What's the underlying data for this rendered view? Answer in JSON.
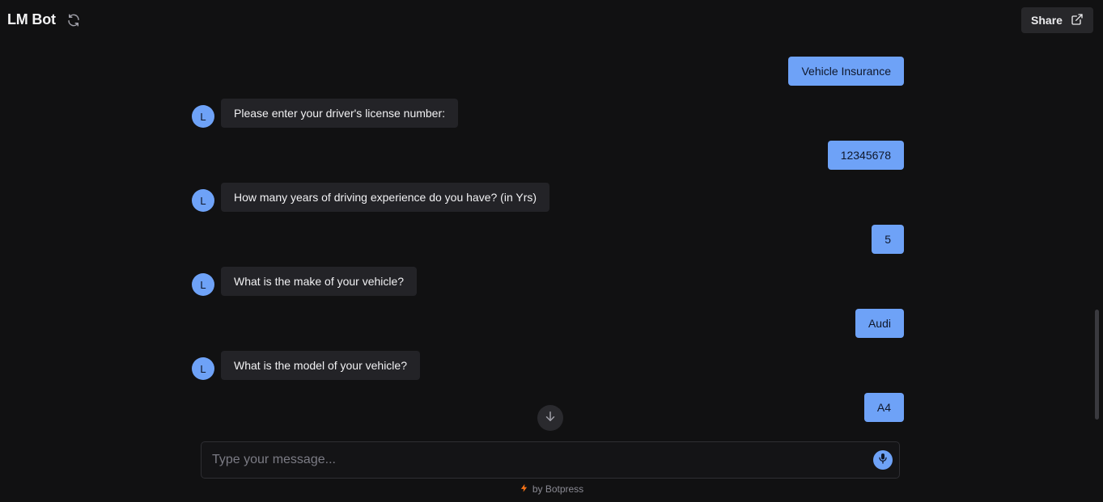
{
  "header": {
    "title": "LM Bot",
    "share_label": "Share"
  },
  "messages": [
    {
      "role": "user",
      "text": "Vehicle Insurance"
    },
    {
      "role": "bot",
      "avatar": "L",
      "text": "Please enter your driver's license number:"
    },
    {
      "role": "user",
      "text": "12345678"
    },
    {
      "role": "bot",
      "avatar": "L",
      "text": "How many years of driving experience do you have? (in Yrs)"
    },
    {
      "role": "user",
      "text": "5"
    },
    {
      "role": "bot",
      "avatar": "L",
      "text": "What is the make of your vehicle?"
    },
    {
      "role": "user",
      "text": "Audi"
    },
    {
      "role": "bot",
      "avatar": "L",
      "text": "What is the model of your vehicle?"
    },
    {
      "role": "user",
      "text": "A4"
    }
  ],
  "composer": {
    "placeholder": "Type your message..."
  },
  "footer": {
    "text": "by Botpress"
  },
  "icons": {
    "refresh": "refresh-icon",
    "share": "external-link-icon",
    "scroll_down": "arrow-down-icon",
    "mic": "microphone-icon",
    "footer": "lightning-bolt-icon"
  },
  "colors": {
    "background": "#111112",
    "accent": "#6ea2f7",
    "bot_bubble": "#232327",
    "footer_bolt": "#f97316"
  }
}
